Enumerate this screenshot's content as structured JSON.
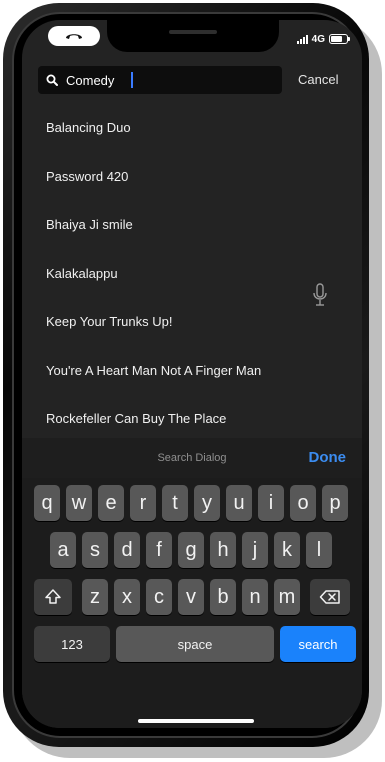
{
  "status": {
    "network": "4G"
  },
  "search": {
    "value": "Comedy",
    "cancel_label": "Cancel"
  },
  "results": [
    "Balancing Duo",
    "Password 420",
    "Bhaiya Ji smile",
    "Kalakalappu",
    "Keep Your Trunks Up!",
    "You're A Heart Man Not A Finger Man",
    "Rockefeller Can Buy The Place"
  ],
  "keyboard": {
    "accessory_title": "Search Dialog",
    "done_label": "Done",
    "row1": [
      "q",
      "w",
      "e",
      "r",
      "t",
      "y",
      "u",
      "i",
      "o",
      "p"
    ],
    "row2": [
      "a",
      "s",
      "d",
      "f",
      "g",
      "h",
      "j",
      "k",
      "l"
    ],
    "row3": [
      "z",
      "x",
      "c",
      "v",
      "b",
      "n",
      "m"
    ],
    "numbers_label": "123",
    "space_label": "space",
    "search_label": "search"
  },
  "colors": {
    "accent": "#1a82fb",
    "done": "#3b8cf0",
    "background": "#232323"
  }
}
